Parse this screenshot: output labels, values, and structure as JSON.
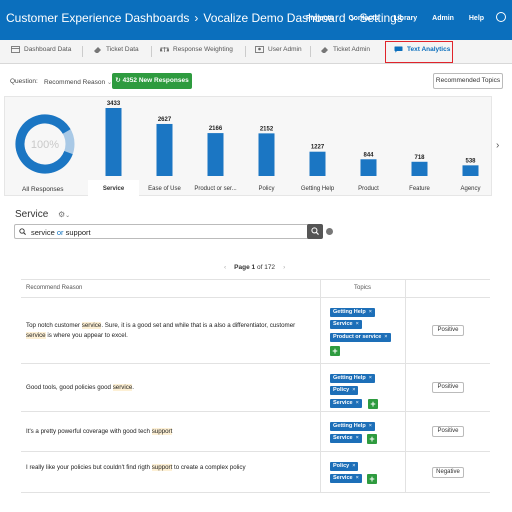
{
  "header": {
    "breadcrumbs": [
      "Customer Experience Dashboards",
      "Vocalize Demo Dashboard",
      "Settings"
    ],
    "nav": [
      "Projects",
      "Contacts",
      "Library",
      "Admin",
      "Help"
    ]
  },
  "tabs": [
    {
      "label": "Dashboard Data",
      "icon": "grid-icon"
    },
    {
      "label": "Ticket Data",
      "icon": "ticket-icon"
    },
    {
      "label": "Response Weighting",
      "icon": "weight-icon"
    },
    {
      "label": "User Admin",
      "icon": "user-icon"
    },
    {
      "label": "Ticket Admin",
      "icon": "ticket-icon"
    },
    {
      "label": "Text Analytics",
      "icon": "chat-icon"
    }
  ],
  "question": {
    "label": "Question:",
    "selected": "Recommend Reason",
    "new_responses": "4352 New Responses",
    "recommended_topics": "Recommended Topics"
  },
  "chart_data": {
    "type": "bar",
    "donut": {
      "value": 100,
      "label": "100%",
      "caption": "All Responses"
    },
    "categories": [
      "Service",
      "Ease of Use",
      "Product or ser...",
      "Policy",
      "Getting Help",
      "Product",
      "Feature",
      "Agency"
    ],
    "values": [
      3433,
      2627,
      2166,
      2152,
      1227,
      844,
      718,
      538
    ],
    "selected": "Service",
    "colors": {
      "bar": "#1b76c3",
      "donut": "#1b76c3",
      "donut_light": "#a9c9e6"
    }
  },
  "section": {
    "title": "Service"
  },
  "search": {
    "term": "service",
    "operator": "or",
    "term2": "support"
  },
  "pager": {
    "prefix": "Page",
    "current": "1",
    "of": "of",
    "total": "172"
  },
  "table": {
    "headers": [
      "Recommend Reason",
      "Topics"
    ],
    "rows": [
      {
        "segments": [
          "Top notch customer ",
          "service",
          ". Sure, it is a good set and while that is a also a differentiator, customer ",
          "service",
          " is where you appear to excel."
        ],
        "tags": [
          "Getting Help",
          "Service",
          "Product or service"
        ],
        "sentiment": "Positive"
      },
      {
        "segments": [
          "Good tools, good policies good ",
          "service",
          "."
        ],
        "tags": [
          "Getting Help",
          "Policy",
          "Service"
        ],
        "sentiment": "Positive"
      },
      {
        "segments": [
          "It's a pretty powerful coverage with good tech ",
          "support"
        ],
        "tags": [
          "Getting Help",
          "Service"
        ],
        "sentiment": "Positive"
      },
      {
        "segments": [
          "I really like your policies but couldn't find rigth ",
          "support",
          " to create a complex policy"
        ],
        "tags": [
          "Policy",
          "Service"
        ],
        "sentiment": "Negative"
      }
    ],
    "tag_remove": "×",
    "add": "+"
  },
  "settings_glyph": "⚙",
  "colors": {
    "brand": "#0b6fbd",
    "green": "#2e9b3f",
    "tag": "#1d6fb8",
    "highlight_border": "#e0242b"
  }
}
